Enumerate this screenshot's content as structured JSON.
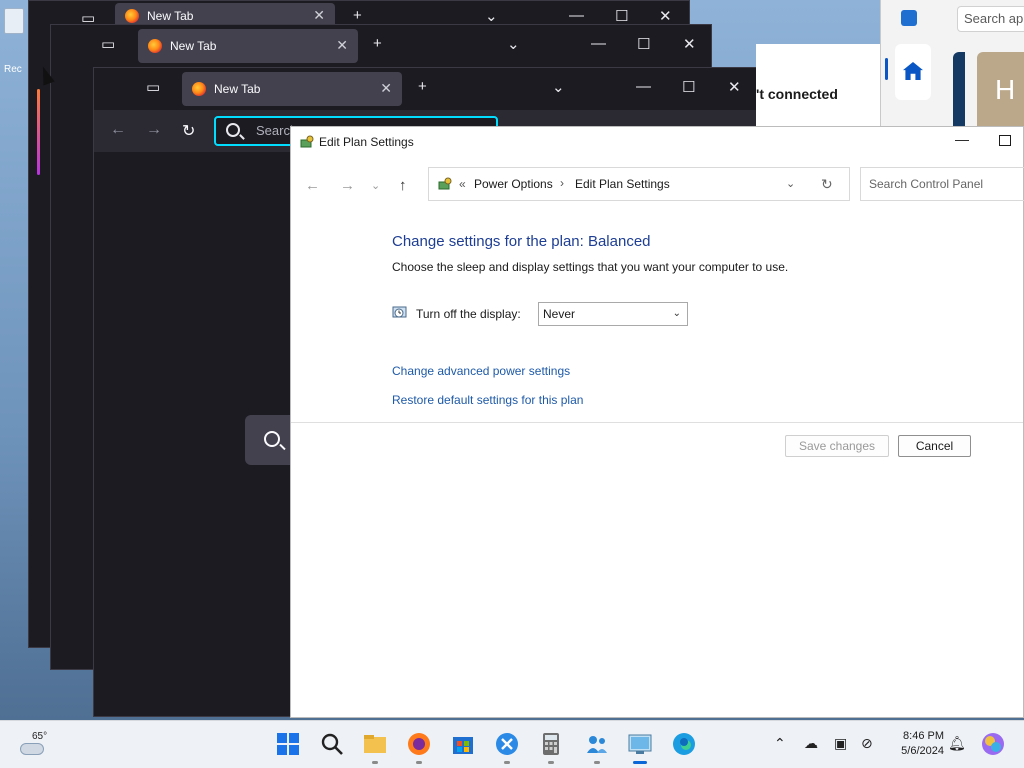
{
  "desktop": {
    "recycle_label": "Rec"
  },
  "firefox_windows": [
    {
      "tab_title": "New Tab"
    },
    {
      "tab_title": "New Tab"
    },
    {
      "tab_title": "New Tab",
      "url_placeholder": "Search"
    }
  ],
  "store": {
    "search_placeholder": "Search ap",
    "hero_letter": "H"
  },
  "network_status": "'t connected",
  "control_panel": {
    "window_title": "Edit Plan Settings",
    "breadcrumb": [
      "Power Options",
      "Edit Plan Settings"
    ],
    "search_placeholder": "Search Control Panel",
    "heading": "Change settings for the plan: Balanced",
    "subheading": "Choose the sleep and display settings that you want your computer to use.",
    "display_label": "Turn off the display:",
    "display_value": "Never",
    "links": {
      "advanced": "Change advanced power settings",
      "restore": "Restore default settings for this plan"
    },
    "buttons": {
      "save": "Save changes",
      "cancel": "Cancel"
    }
  },
  "taskbar": {
    "weather_temp": "65°",
    "time": "8:46 PM",
    "date": "5/6/2024",
    "apps": [
      "start-icon",
      "search-icon",
      "file-explorer-icon",
      "firefox-icon",
      "store-icon",
      "snipping-tool-icon",
      "calculator-icon",
      "teams-icon",
      "control-panel-icon",
      "edge-icon"
    ],
    "colors": {
      "accent": "#0a67d8"
    }
  }
}
